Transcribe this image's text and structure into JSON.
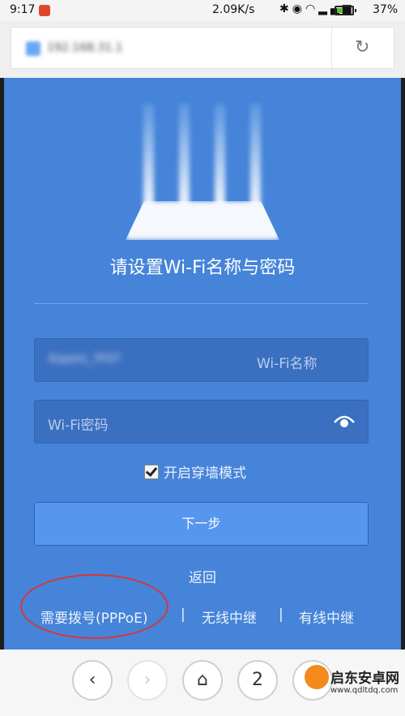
{
  "status_bar": {
    "time": "9:17",
    "network_speed": "2.09K/s",
    "battery_percent": "37%",
    "battery_level": 0.37,
    "icons": [
      "app-notification-icon",
      "bluetooth-icon",
      "alarm-icon",
      "wifi-icon",
      "signal-icon",
      "battery-icon"
    ]
  },
  "browser": {
    "url_text": "192.168.31.1",
    "refresh_icon": "refresh-icon"
  },
  "setup": {
    "title": "请设置Wi-Fi名称与密码",
    "ssid_value": "Xiaomi_7F07",
    "ssid_label": "Wi-Fi名称",
    "password_placeholder": "Wi-Fi密码",
    "show_password_icon": "eye-icon",
    "wall_mode_label": "开启穿墙模式",
    "wall_mode_checked": true,
    "next_button": "下一步",
    "back_link": "返回",
    "bottom_links": [
      "需要拨号(PPPoE)",
      "无线中继",
      "有线中继"
    ],
    "separator": "|"
  },
  "bottom_nav": {
    "back_icon": "chevron-left-icon",
    "forward_icon": "chevron-right-icon",
    "home_icon": "home-icon",
    "tab_count": "2",
    "menu_icon": "menu-icon"
  },
  "watermark": {
    "name": "启东安卓网",
    "url": "www.qdltdq.com"
  },
  "colors": {
    "page_bg": "#4584d9",
    "annotation": "#d8353a"
  }
}
